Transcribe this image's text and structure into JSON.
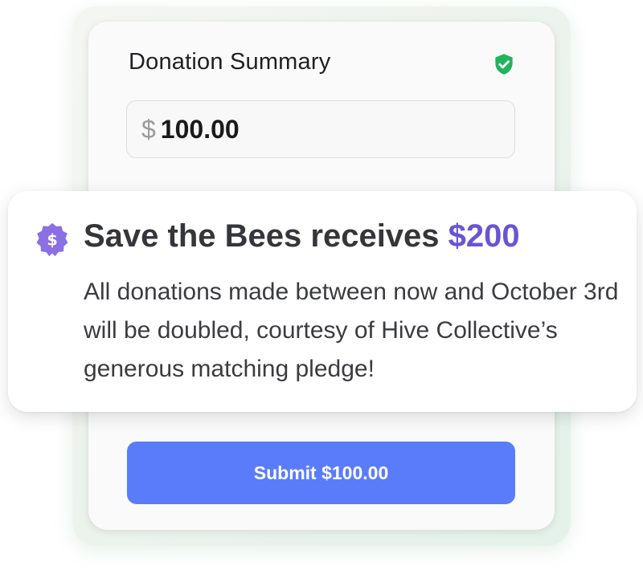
{
  "summary_card": {
    "title": "Donation Summary",
    "verified_icon": "shield-check-icon",
    "amount_field": {
      "currency_symbol": "$",
      "value": "100.00"
    },
    "submit_label": "Submit $100.00"
  },
  "promo": {
    "icon": "dollar-badge-icon",
    "heading_prefix": "Save the Bees receives",
    "heading_amount": "$200",
    "body": "All donations made between now and October 3rd will be doubled, courtesy of Hive Collective’s generous matching pledge!"
  },
  "colors": {
    "accent_button": "#5b7cfa",
    "accent_purple": "#6a54d6",
    "verified_green": "#22b35e"
  }
}
